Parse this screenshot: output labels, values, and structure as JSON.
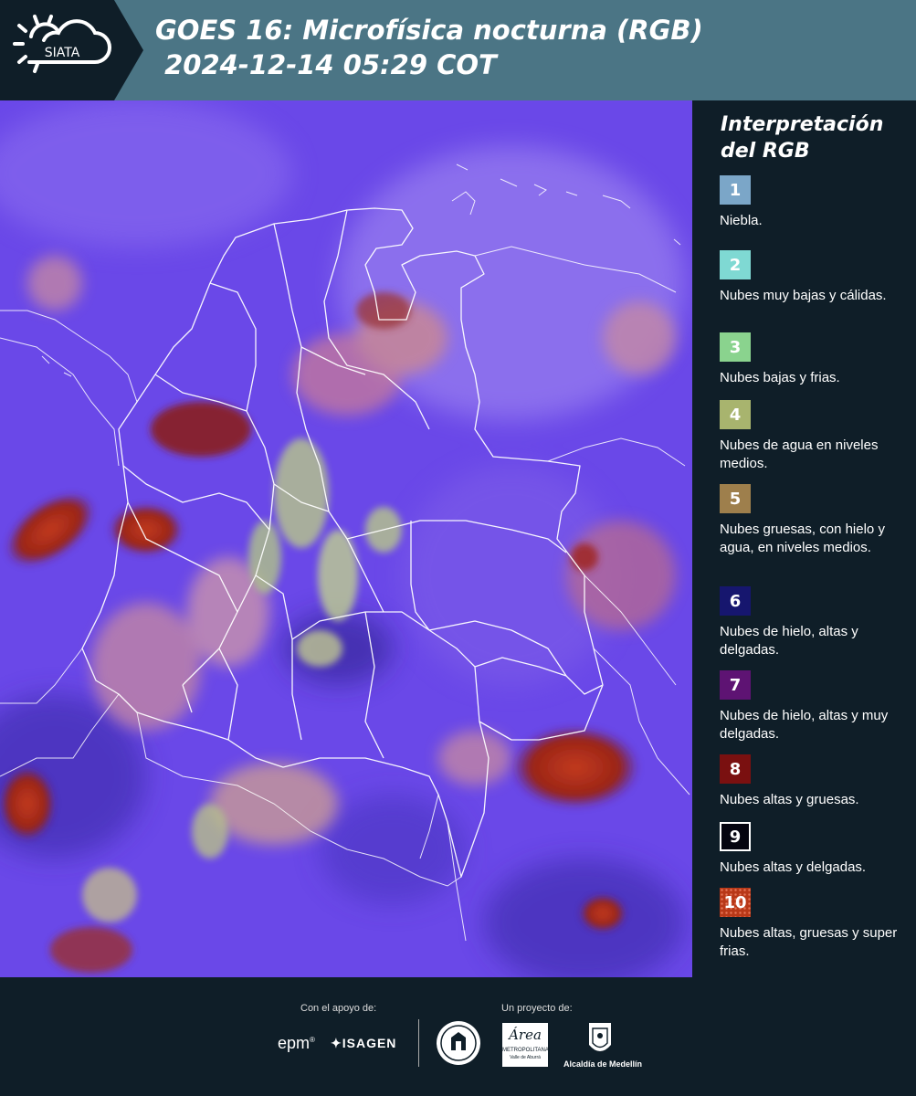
{
  "header": {
    "logo_text": "SIATA",
    "title_line1": "GOES 16: Microfísica nocturna (RGB)",
    "title_line2": " 2024-12-14 05:29 COT"
  },
  "legend": {
    "title": "Interpretación del RGB",
    "items": [
      {
        "num": "1",
        "label": "Niebla.",
        "color": "#7ba6c8"
      },
      {
        "num": "2",
        "label": "Nubes muy bajas y cálidas.",
        "color": "#7fd9d3"
      },
      {
        "num": "3",
        "label": "Nubes bajas y frias.",
        "color": "#8ad38e"
      },
      {
        "num": "4",
        "label": "Nubes de agua en niveles medios.",
        "color": "#a8b46e"
      },
      {
        "num": "5",
        "label": "Nubes gruesas, con hielo y agua, en niveles medios.",
        "color": "#9e7f4c"
      },
      {
        "num": "6",
        "label": "Nubes de hielo, altas y delgadas.",
        "color": "#16166e"
      },
      {
        "num": "7",
        "label": "Nubes de hielo, altas y muy delgadas.",
        "color": "#5e1373"
      },
      {
        "num": "8",
        "label": "Nubes altas y gruesas.",
        "color": "#7a1010"
      },
      {
        "num": "9",
        "label": "Nubes altas y delgadas.",
        "color": "#050510"
      },
      {
        "num": "10",
        "label": "Nubes altas, gruesas y super frias.",
        "color": "#b83818"
      }
    ]
  },
  "footer": {
    "support_label": "Con el apoyo de:",
    "project_label": "Un proyecto de:",
    "sponsor_epm": "epm",
    "sponsor_isagen": "ISAGEN",
    "area_name": "Área",
    "area_sub": "METROPOLITANA",
    "area_sub2": "Valle de Aburrá",
    "alcaldia": "Alcaldía de Medellín"
  },
  "colors": {
    "header_bg": "#4b7585",
    "panel_bg": "#0f1e28",
    "map_base": "#6a48e8"
  }
}
